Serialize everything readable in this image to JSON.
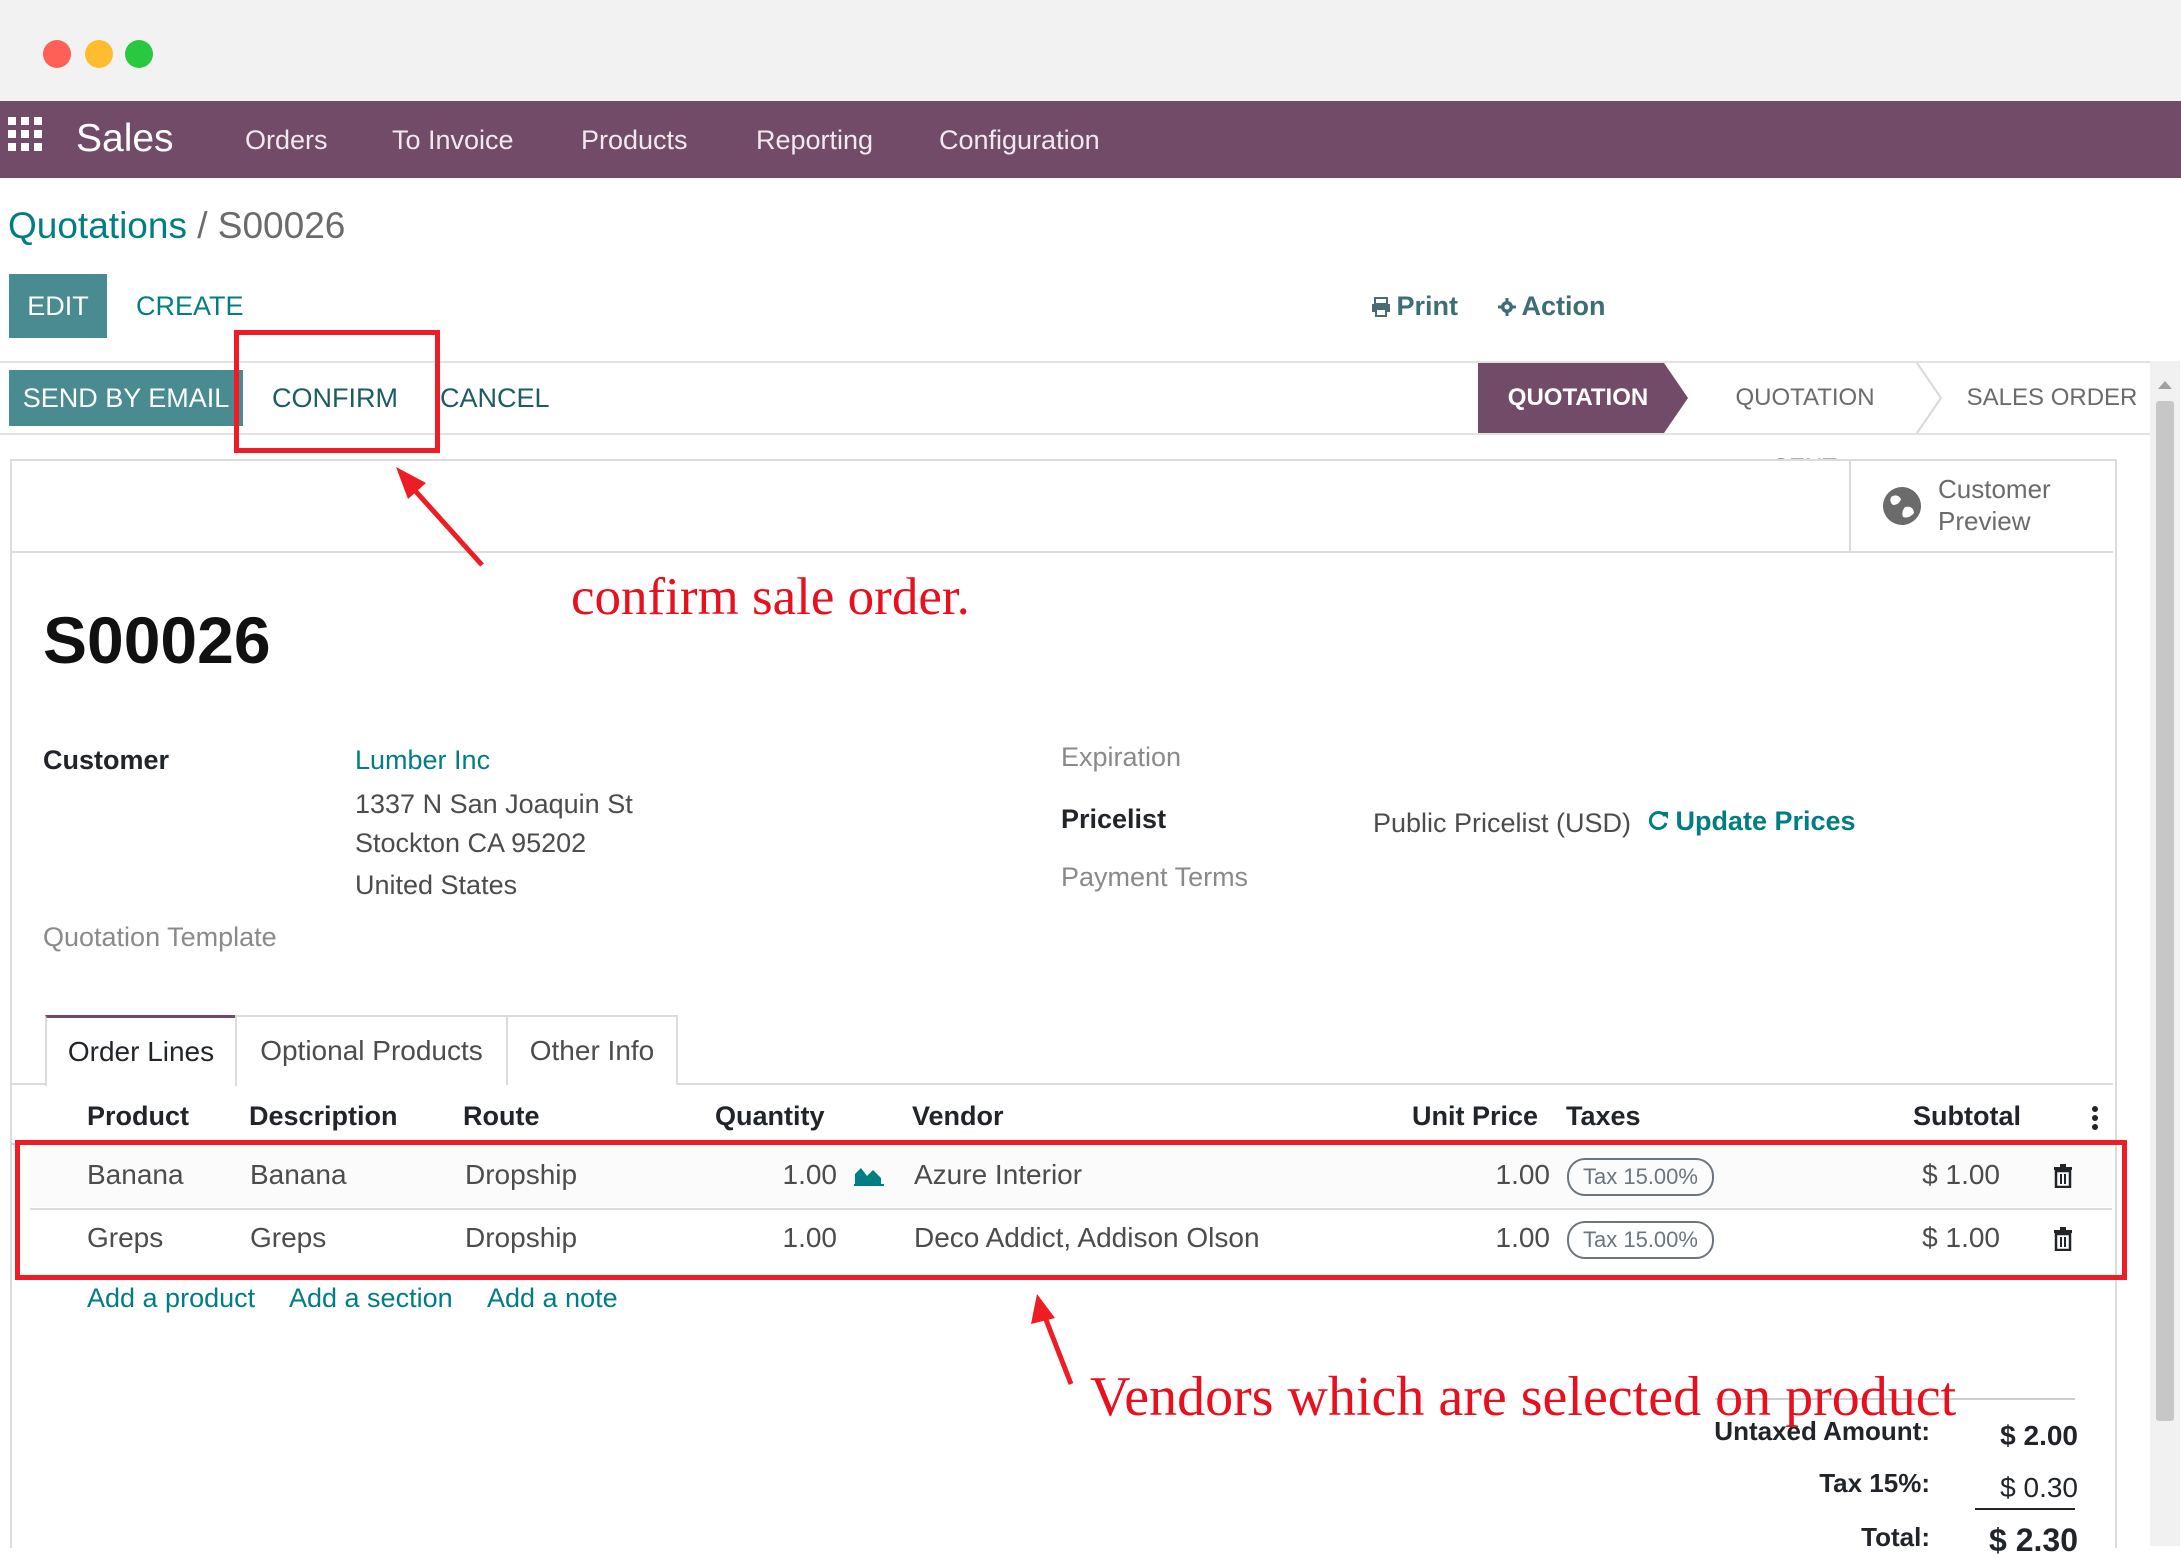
{
  "colors": {
    "brand": "#714b67",
    "accent_teal": "#017e84",
    "primary_button": "#4a8b91",
    "annotation_red": "#ee1c24"
  },
  "navbar": {
    "apps_icon": "apps-grid-icon",
    "brand": "Sales",
    "menu": [
      "Orders",
      "To Invoice",
      "Products",
      "Reporting",
      "Configuration"
    ]
  },
  "breadcrumb": {
    "parent": "Quotations",
    "separator": " / ",
    "current": "S00026"
  },
  "control_panel": {
    "edit_label": "EDIT",
    "create_label": "CREATE",
    "print_label": "Print",
    "print_icon": "print-icon",
    "action_label": "Action",
    "action_icon": "gear-icon"
  },
  "header_buttons": {
    "send_by_email": "SEND BY EMAIL",
    "confirm": "CONFIRM",
    "cancel": "CANCEL"
  },
  "status_stages": [
    {
      "label": "QUOTATION",
      "active": true
    },
    {
      "label": "QUOTATION SENT",
      "active": false
    },
    {
      "label": "SALES ORDER",
      "active": false
    }
  ],
  "button_box": {
    "customer_preview_line1": "Customer",
    "customer_preview_line2": "Preview",
    "icon": "globe-icon"
  },
  "record": {
    "name": "S00026",
    "customer_label": "Customer",
    "customer_name": "Lumber Inc",
    "address_line1": "1337 N San Joaquin St",
    "address_line2": "Stockton CA 95202",
    "address_line3": "United States",
    "quotation_template_label": "Quotation Template",
    "expiration_label": "Expiration",
    "pricelist_label": "Pricelist",
    "pricelist_value": "Public Pricelist (USD)",
    "update_prices_label": "Update Prices",
    "update_prices_icon": "refresh-icon",
    "payment_terms_label": "Payment Terms"
  },
  "tabs": [
    {
      "label": "Order Lines",
      "active": true
    },
    {
      "label": "Optional Products",
      "active": false
    },
    {
      "label": "Other Info",
      "active": false
    }
  ],
  "order_lines": {
    "columns": [
      "Product",
      "Description",
      "Route",
      "Quantity",
      "Vendor",
      "Unit Price",
      "Taxes",
      "Subtotal"
    ],
    "rows": [
      {
        "product": "Banana",
        "description": "Banana",
        "route": "Dropship",
        "quantity": "1.00",
        "vendor": "Azure Interior",
        "unit_price": "1.00",
        "tax": "Tax 15.00%",
        "subtotal": "$ 1.00"
      },
      {
        "product": "Greps",
        "description": "Greps",
        "route": "Dropship",
        "quantity": "1.00",
        "vendor": "Deco Addict, Addison Olson",
        "unit_price": "1.00",
        "tax": "Tax 15.00%",
        "subtotal": "$ 1.00"
      }
    ],
    "add_product": "Add a product",
    "add_section": "Add a section",
    "add_note": "Add a note"
  },
  "totals": {
    "untaxed_label": "Untaxed Amount:",
    "untaxed_value": "$ 2.00",
    "tax_label": "Tax 15%:",
    "tax_value": "$ 0.30",
    "total_label": "Total:",
    "total_value": "$ 2.30"
  },
  "annotations": {
    "confirm_note": "confirm sale order.",
    "vendor_note": "Vendors which are selected on product"
  }
}
